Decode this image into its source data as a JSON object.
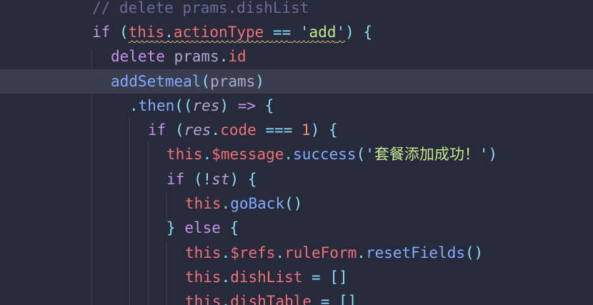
{
  "lines": [
    {
      "t": [
        {
          "c": "cm",
          "v": "// delete prams.dishList"
        }
      ]
    },
    {
      "t": [
        {
          "c": "kw",
          "v": "if"
        },
        {
          "c": "plain",
          "v": " "
        },
        {
          "c": "punc",
          "v": "("
        },
        {
          "c": "this",
          "v": "this"
        },
        {
          "c": "punc",
          "v": "."
        },
        {
          "c": "prop",
          "v": "actionType"
        },
        {
          "c": "plain",
          "v": " "
        },
        {
          "c": "punc",
          "v": "=="
        },
        {
          "c": "plain",
          "v": " "
        },
        {
          "c": "punc",
          "v": "'"
        },
        {
          "c": "str",
          "v": "add"
        },
        {
          "c": "punc",
          "v": "'"
        },
        {
          "c": "punc",
          "v": ")"
        },
        {
          "c": "plain",
          "v": " "
        },
        {
          "c": "punc",
          "v": "{"
        }
      ]
    },
    {
      "t": [
        {
          "c": "kw",
          "v": "delete"
        },
        {
          "c": "plain",
          "v": " prams"
        },
        {
          "c": "punc",
          "v": "."
        },
        {
          "c": "prop",
          "v": "id"
        }
      ]
    },
    {
      "t": [
        {
          "c": "fn",
          "v": "addSetmeal"
        },
        {
          "c": "punc",
          "v": "("
        },
        {
          "c": "plain",
          "v": "prams"
        },
        {
          "c": "punc",
          "v": ")"
        }
      ]
    },
    {
      "t": [
        {
          "c": "punc",
          "v": "."
        },
        {
          "c": "fn",
          "v": "then"
        },
        {
          "c": "punc",
          "v": "(("
        },
        {
          "c": "param",
          "v": "res"
        },
        {
          "c": "punc",
          "v": ")"
        },
        {
          "c": "plain",
          "v": " "
        },
        {
          "c": "kw",
          "v": "=>"
        },
        {
          "c": "plain",
          "v": " "
        },
        {
          "c": "punc",
          "v": "{"
        }
      ]
    },
    {
      "t": [
        {
          "c": "kw",
          "v": "if"
        },
        {
          "c": "plain",
          "v": " "
        },
        {
          "c": "punc",
          "v": "("
        },
        {
          "c": "param",
          "v": "res"
        },
        {
          "c": "punc",
          "v": "."
        },
        {
          "c": "prop",
          "v": "code"
        },
        {
          "c": "plain",
          "v": " "
        },
        {
          "c": "punc",
          "v": "==="
        },
        {
          "c": "plain",
          "v": " "
        },
        {
          "c": "num",
          "v": "1"
        },
        {
          "c": "punc",
          "v": ")"
        },
        {
          "c": "plain",
          "v": " "
        },
        {
          "c": "punc",
          "v": "{"
        }
      ]
    },
    {
      "t": [
        {
          "c": "this",
          "v": "this"
        },
        {
          "c": "punc",
          "v": "."
        },
        {
          "c": "prop",
          "v": "$message"
        },
        {
          "c": "punc",
          "v": "."
        },
        {
          "c": "fn",
          "v": "success"
        },
        {
          "c": "punc",
          "v": "("
        },
        {
          "c": "punc",
          "v": "'"
        },
        {
          "c": "str cjk",
          "v": "套餐添加成功！"
        },
        {
          "c": "punc",
          "v": "'"
        },
        {
          "c": "punc",
          "v": ")"
        }
      ]
    },
    {
      "t": [
        {
          "c": "kw",
          "v": "if"
        },
        {
          "c": "plain",
          "v": " "
        },
        {
          "c": "punc",
          "v": "(!"
        },
        {
          "c": "param",
          "v": "st"
        },
        {
          "c": "punc",
          "v": ")"
        },
        {
          "c": "plain",
          "v": " "
        },
        {
          "c": "punc",
          "v": "{"
        }
      ]
    },
    {
      "t": [
        {
          "c": "this",
          "v": "this"
        },
        {
          "c": "punc",
          "v": "."
        },
        {
          "c": "fn",
          "v": "goBack"
        },
        {
          "c": "punc",
          "v": "()"
        }
      ]
    },
    {
      "t": [
        {
          "c": "punc",
          "v": "}"
        },
        {
          "c": "plain",
          "v": " "
        },
        {
          "c": "kw",
          "v": "else"
        },
        {
          "c": "plain",
          "v": " "
        },
        {
          "c": "punc",
          "v": "{"
        }
      ]
    },
    {
      "t": [
        {
          "c": "this",
          "v": "this"
        },
        {
          "c": "punc",
          "v": "."
        },
        {
          "c": "prop",
          "v": "$refs"
        },
        {
          "c": "punc",
          "v": "."
        },
        {
          "c": "prop",
          "v": "ruleForm"
        },
        {
          "c": "punc",
          "v": "."
        },
        {
          "c": "fn",
          "v": "resetFields"
        },
        {
          "c": "punc",
          "v": "()"
        }
      ]
    },
    {
      "t": [
        {
          "c": "this",
          "v": "this"
        },
        {
          "c": "punc",
          "v": "."
        },
        {
          "c": "prop",
          "v": "dishList"
        },
        {
          "c": "plain",
          "v": " "
        },
        {
          "c": "punc",
          "v": "="
        },
        {
          "c": "plain",
          "v": " "
        },
        {
          "c": "punc",
          "v": "[]"
        }
      ]
    },
    {
      "t": [
        {
          "c": "this",
          "v": "this"
        },
        {
          "c": "punc",
          "v": "."
        },
        {
          "c": "prop",
          "v": "dishTable"
        },
        {
          "c": "plain",
          "v": " "
        },
        {
          "c": "punc",
          "v": "="
        },
        {
          "c": "plain",
          "v": " "
        },
        {
          "c": "punc",
          "v": "[]"
        }
      ]
    }
  ],
  "colors": {
    "background": "#272a3a",
    "current_line": "#3a3d4e",
    "keyword": "#c792ea",
    "this": "#f07178",
    "function": "#82aaff",
    "string": "#c3e88d",
    "number": "#f78c6c",
    "comment": "#676e95"
  }
}
